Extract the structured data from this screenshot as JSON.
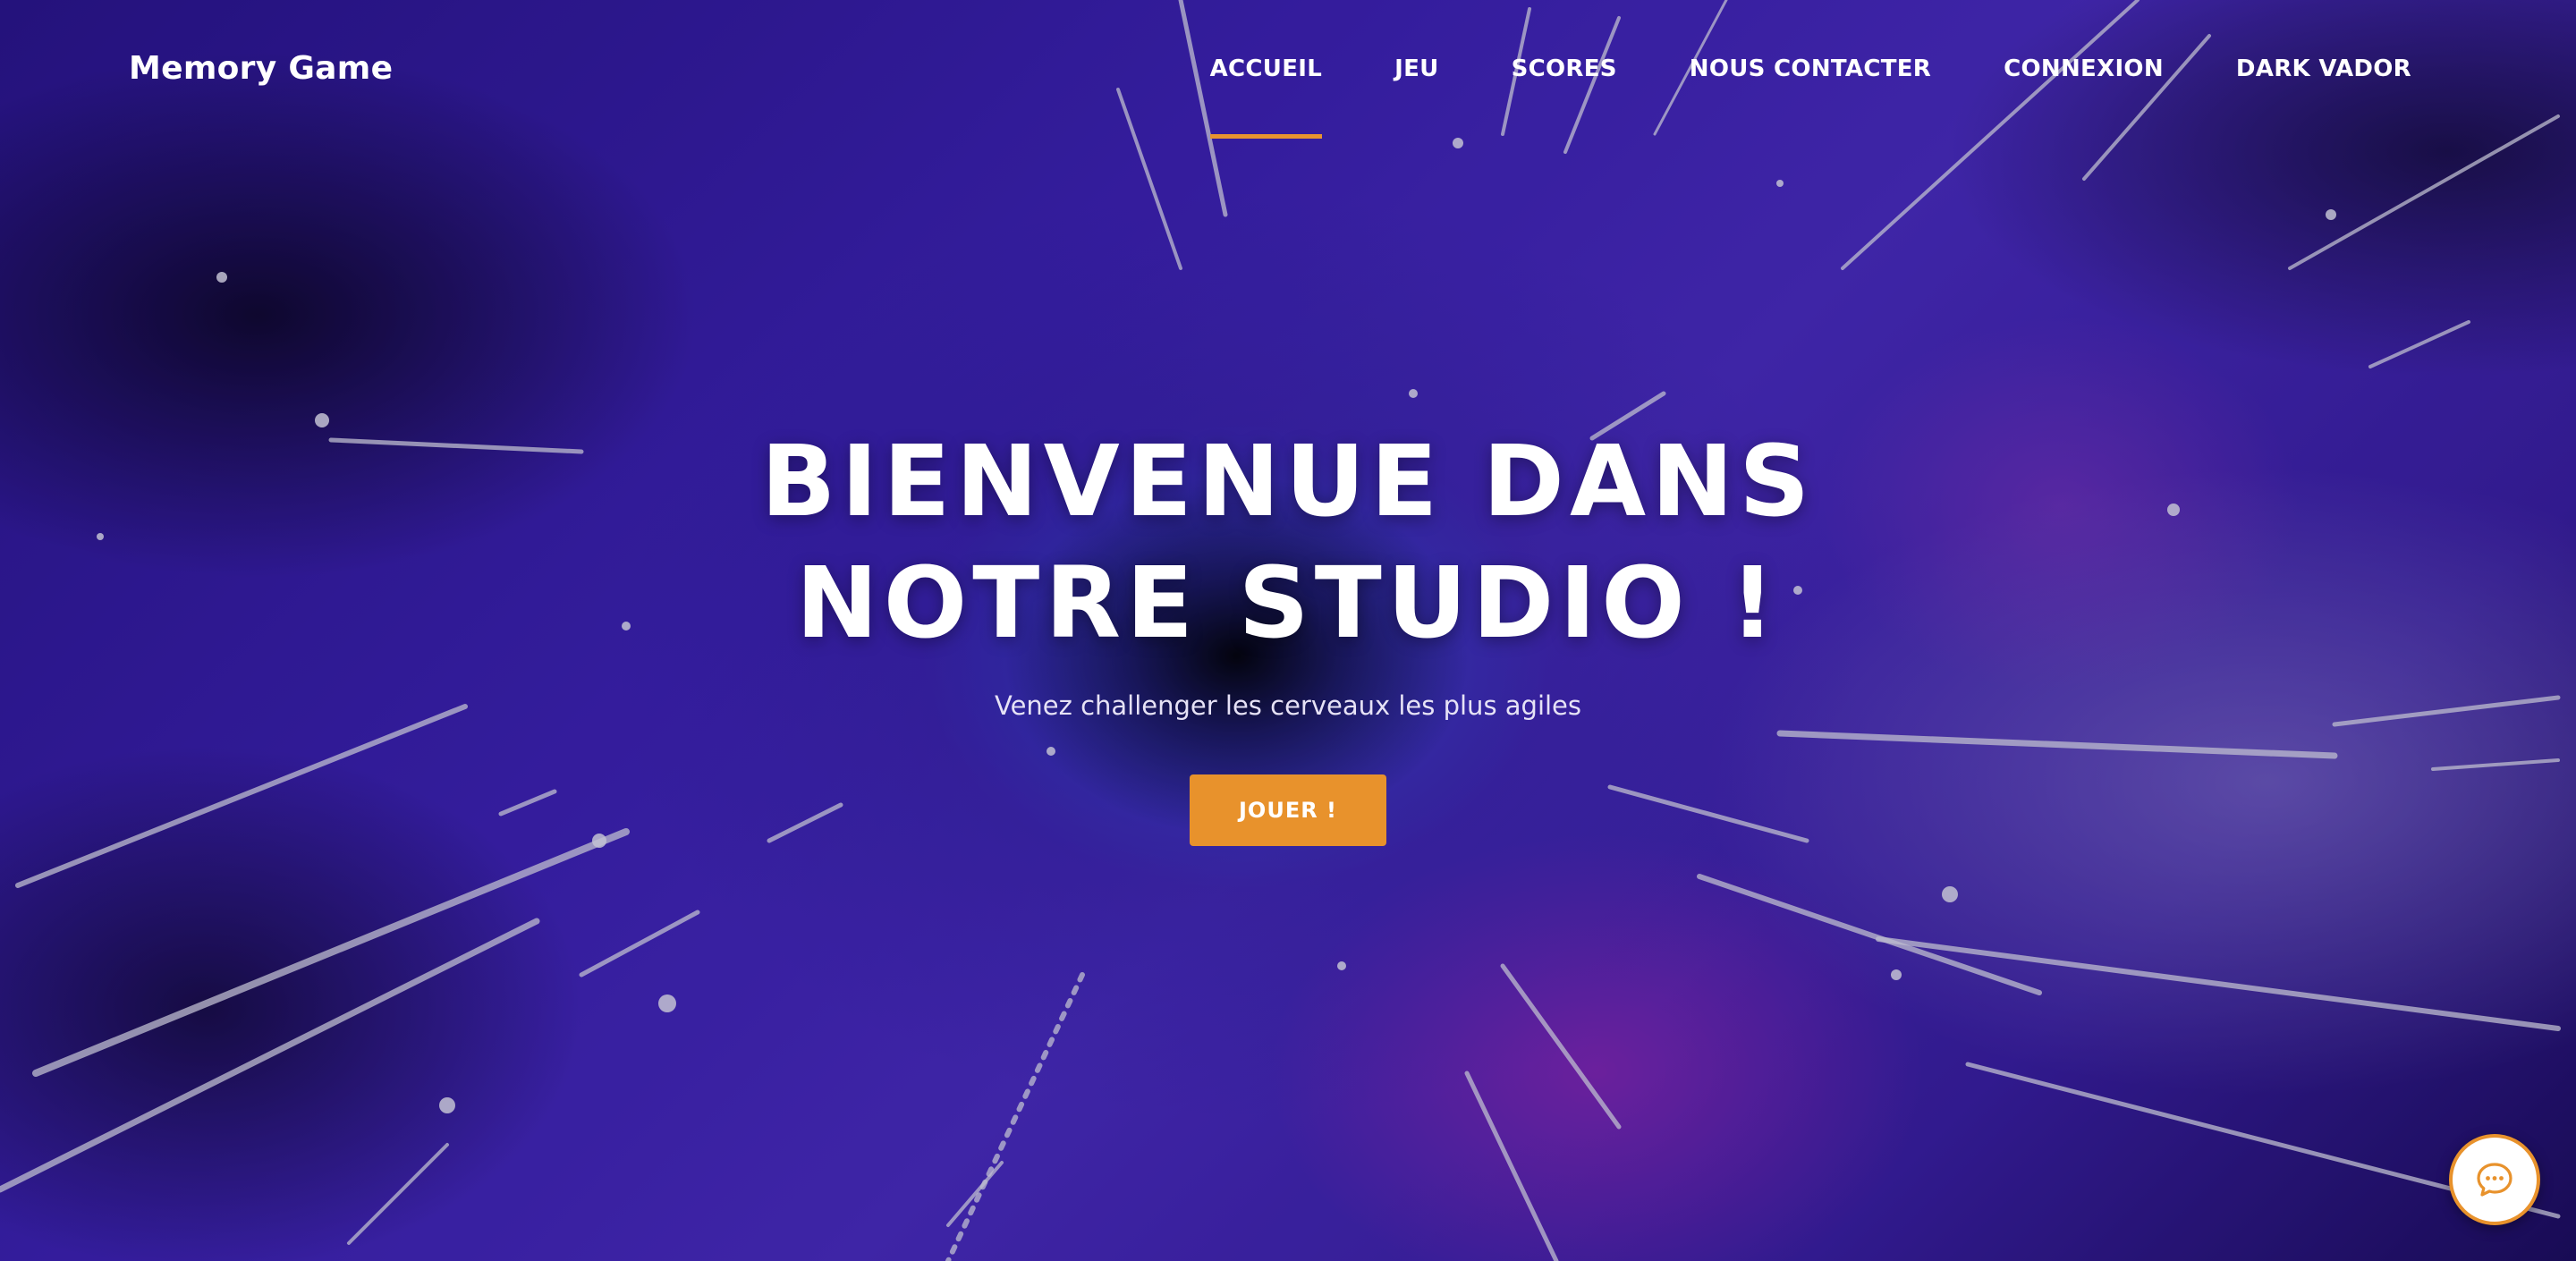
{
  "header": {
    "logo": "Memory Game",
    "nav": [
      {
        "label": "ACCUEIL",
        "active": true
      },
      {
        "label": "JEU",
        "active": false
      },
      {
        "label": "SCORES",
        "active": false
      },
      {
        "label": "NOUS CONTACTER",
        "active": false
      },
      {
        "label": "CONNEXION",
        "active": false
      },
      {
        "label": "DARK VADOR",
        "active": false
      }
    ]
  },
  "hero": {
    "title_line1": "BIENVENUE DANS",
    "title_line2": "NOTRE STUDIO !",
    "subtitle": "Venez challenger les cerveaux les plus agiles",
    "cta_label": "JOUER !"
  },
  "chat": {
    "icon": "chat-bubble-icon"
  },
  "colors": {
    "accent": "#e8922c",
    "text": "#ffffff",
    "background": "#3d22b8"
  }
}
